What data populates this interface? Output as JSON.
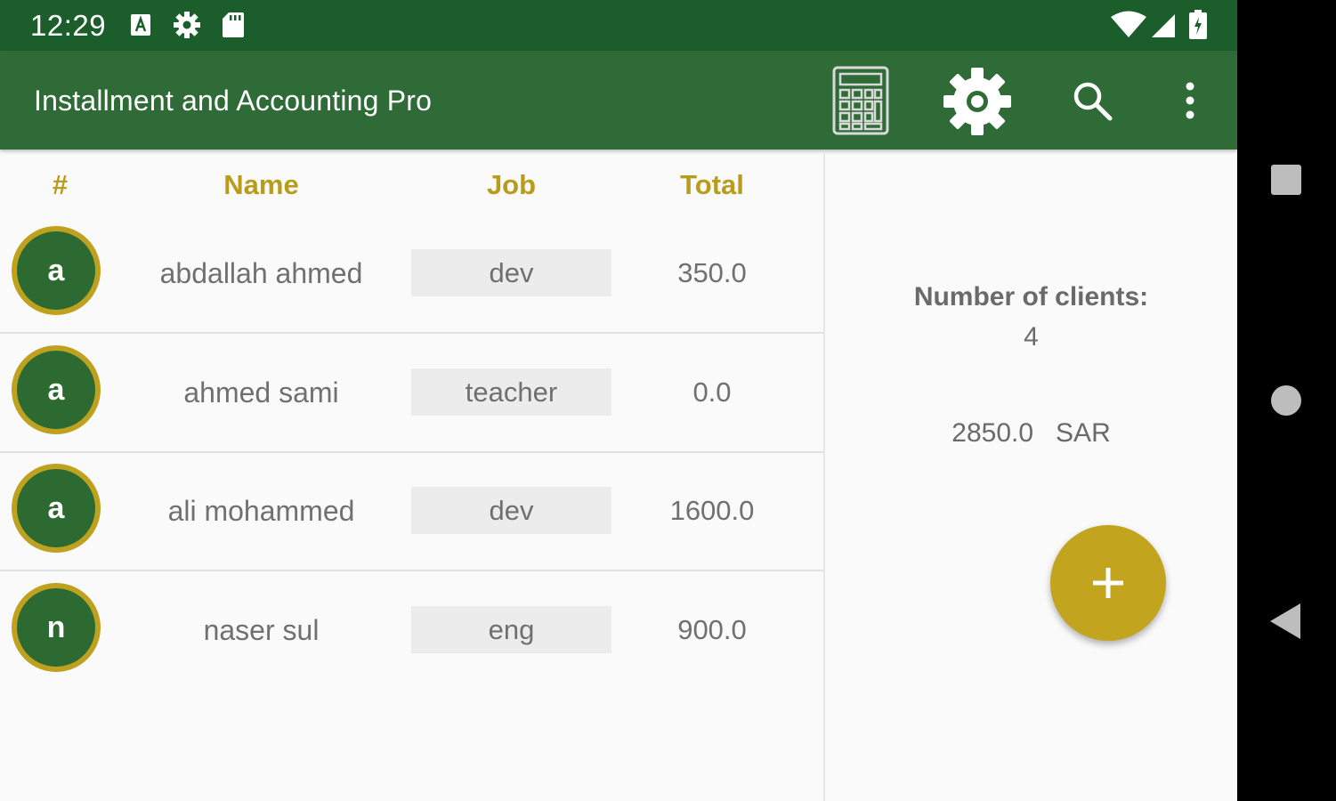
{
  "status_bar": {
    "time": "12:29",
    "left_icons": [
      "keyboard-a-icon",
      "gear-icon",
      "sd-card-icon"
    ],
    "right_icons": [
      "wifi-icon",
      "signal-icon",
      "battery-icon"
    ]
  },
  "app_bar": {
    "title": "Installment and Accounting Pro",
    "actions": [
      "calculator-icon",
      "settings-icon",
      "search-icon",
      "more-vert-icon"
    ]
  },
  "table": {
    "headers": {
      "index": "#",
      "name": "Name",
      "job": "Job",
      "total": "Total"
    },
    "rows": [
      {
        "avatar_letter": "a",
        "name": "abdallah ahmed",
        "job": "dev",
        "total": "350.0"
      },
      {
        "avatar_letter": "a",
        "name": "ahmed sami",
        "job": "teacher",
        "total": "0.0"
      },
      {
        "avatar_letter": "a",
        "name": "ali mohammed",
        "job": "dev",
        "total": "1600.0"
      },
      {
        "avatar_letter": "n",
        "name": "naser sul",
        "job": "eng",
        "total": "900.0"
      }
    ]
  },
  "summary": {
    "clients_label": "Number of clients:",
    "clients_count": "4",
    "total_amount": "2850.0",
    "currency": "SAR"
  },
  "fab": {
    "icon": "plus-icon"
  },
  "nav_bar": {
    "icons": [
      "recents-icon",
      "home-icon",
      "back-icon"
    ]
  },
  "colors": {
    "status_bar": "#1b5e2b",
    "app_bar": "#2e6b36",
    "accent_gold": "#bfa120",
    "avatar_green": "#2c6a31"
  }
}
